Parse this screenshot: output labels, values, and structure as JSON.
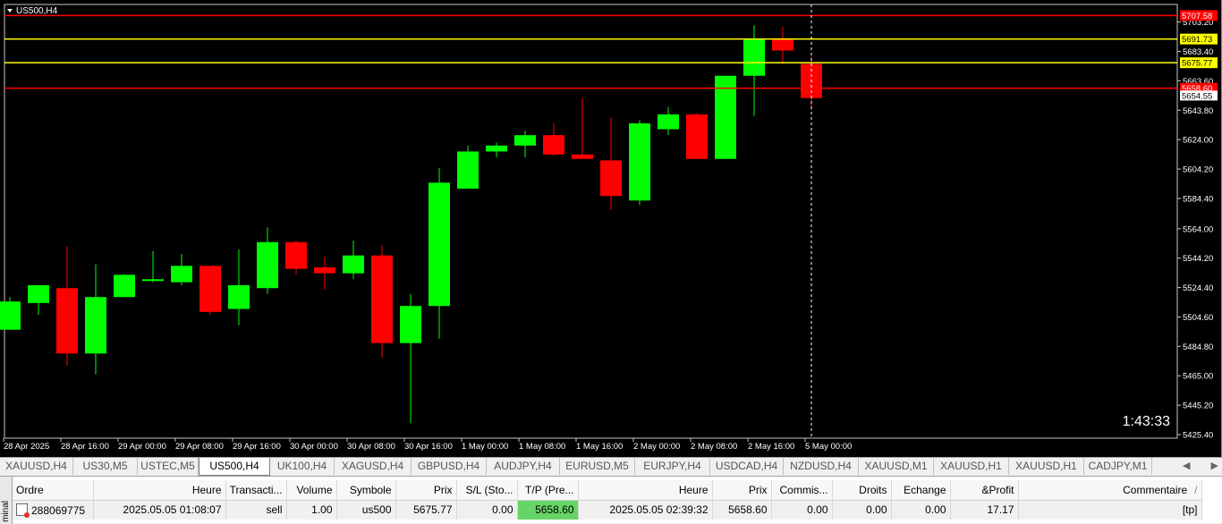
{
  "chart": {
    "title": "US500,H4",
    "timer": "1:43:33",
    "y_range": [
      5423,
      5715
    ],
    "price_labels": [
      "5703.20",
      "5683.40",
      "5663.60",
      "5643.80",
      "5624.00",
      "5604.20",
      "5584.40",
      "5564.00",
      "5544.20",
      "5524.40",
      "5504.60",
      "5484.80",
      "5465.00",
      "5445.20",
      "5425.40"
    ],
    "time_labels": [
      "28 Apr 2025",
      "28 Apr 16:00",
      "29 Apr 00:00",
      "29 Apr 08:00",
      "29 Apr 16:00",
      "30 Apr 00:00",
      "30 Apr 08:00",
      "30 Apr 16:00",
      "1 May 00:00",
      "1 May 08:00",
      "1 May 16:00",
      "2 May 00:00",
      "2 May 08:00",
      "2 May 16:00",
      "5 May 00:00"
    ],
    "levels": [
      {
        "price": 5707.58,
        "label": "5707.58",
        "line_color": "#ff0000",
        "badge_color": "#ff0000",
        "text_color": "#ffffff"
      },
      {
        "price": 5691.73,
        "label": "5691.73",
        "line_color": "#ffff00",
        "badge_color": "#ffff00",
        "text_color": "#000000"
      },
      {
        "price": 5675.77,
        "label": "5675.77",
        "line_color": "#ffff00",
        "badge_color": "#ffff00",
        "text_color": "#000000"
      },
      {
        "price": 5658.6,
        "label": "5658.60",
        "line_color": "#ff0000",
        "badge_color": "#ff0000",
        "text_color": "#ffffff"
      }
    ],
    "current_price": {
      "price": 5654.55,
      "label": "5654.55"
    },
    "colors": {
      "bull": "#00ff00",
      "bear": "#ff0000",
      "wick_bull": "#00ff00",
      "wick_bear": "#ff0000",
      "background": "#000000",
      "text": "#ffffff"
    }
  },
  "chart_data": {
    "type": "candlestick",
    "series": [
      {
        "name": "US500,H4",
        "candles": [
          {
            "o": 5496,
            "h": 5518,
            "l": 5496,
            "c": 5515
          },
          {
            "o": 5514,
            "h": 5524,
            "l": 5506,
            "c": 5526
          },
          {
            "o": 5524,
            "h": 5552,
            "l": 5472,
            "c": 5480
          },
          {
            "o": 5480,
            "h": 5540,
            "l": 5466,
            "c": 5518
          },
          {
            "o": 5518,
            "h": 5533,
            "l": 5518,
            "c": 5533
          },
          {
            "o": 5530,
            "h": 5549,
            "l": 5528,
            "c": 5530
          },
          {
            "o": 5528,
            "h": 5547,
            "l": 5526,
            "c": 5539
          },
          {
            "o": 5539,
            "h": 5539,
            "l": 5506,
            "c": 5508
          },
          {
            "o": 5510,
            "h": 5550,
            "l": 5499,
            "c": 5526
          },
          {
            "o": 5524,
            "h": 5565,
            "l": 5520,
            "c": 5555
          },
          {
            "o": 5555,
            "h": 5556,
            "l": 5533,
            "c": 5537
          },
          {
            "o": 5538,
            "h": 5545,
            "l": 5523,
            "c": 5534
          },
          {
            "o": 5534,
            "h": 5556,
            "l": 5530,
            "c": 5546
          },
          {
            "o": 5546,
            "h": 5553,
            "l": 5477,
            "c": 5487
          },
          {
            "o": 5487,
            "h": 5520,
            "l": 5433,
            "c": 5512
          },
          {
            "o": 5512,
            "h": 5605,
            "l": 5490,
            "c": 5595
          },
          {
            "o": 5591,
            "h": 5620,
            "l": 5591,
            "c": 5616
          },
          {
            "o": 5616,
            "h": 5622,
            "l": 5612,
            "c": 5620
          },
          {
            "o": 5620,
            "h": 5630,
            "l": 5612,
            "c": 5627
          },
          {
            "o": 5627,
            "h": 5635,
            "l": 5613,
            "c": 5614
          },
          {
            "o": 5614,
            "h": 5652,
            "l": 5611,
            "c": 5611
          },
          {
            "o": 5610,
            "h": 5639,
            "l": 5577,
            "c": 5586
          },
          {
            "o": 5583,
            "h": 5637,
            "l": 5580,
            "c": 5635
          },
          {
            "o": 5631,
            "h": 5646,
            "l": 5627,
            "c": 5641
          },
          {
            "o": 5641,
            "h": 5642,
            "l": 5611,
            "c": 5611
          },
          {
            "o": 5611,
            "h": 5667,
            "l": 5611,
            "c": 5667
          },
          {
            "o": 5667,
            "h": 5701,
            "l": 5640,
            "c": 5692
          },
          {
            "o": 5692,
            "h": 5700,
            "l": 5675,
            "c": 5684
          },
          {
            "o": 5675,
            "h": 5680,
            "l": 5644,
            "c": 5652
          }
        ]
      }
    ],
    "x": [
      "28 Apr 2025",
      "28 Apr 16:00",
      "29 Apr 00:00",
      "29 Apr 08:00",
      "29 Apr 16:00",
      "30 Apr 00:00",
      "30 Apr 08:00",
      "30 Apr 16:00",
      "1 May 00:00",
      "1 May 08:00",
      "1 May 16:00",
      "2 May 00:00",
      "2 May 08:00",
      "2 May 16:00",
      "5 May 00:00"
    ],
    "ylim": [
      5423,
      5715
    ],
    "grid": false
  },
  "symbol_tabs": {
    "items": [
      "XAUUSD,H4",
      "US30,M5",
      "USTEC,M5",
      "US500,H4",
      "UK100,H4",
      "XAGUSD,H4",
      "GBPUSD,H4",
      "AUDJPY,H4",
      "EURUSD,M5",
      "EURJPY,H4",
      "USDCAD,H4",
      "NZDUSD,H4",
      "XAUUSD,M1",
      "XAUUSD,H1",
      "XAUUSD,H1",
      "CADJPY,M1"
    ],
    "active_index": 3
  },
  "terminal": {
    "side_label": "minal",
    "headers": [
      "Ordre",
      "Heure",
      "Transacti...",
      "Volume",
      "Symbole",
      "Prix",
      "S/L (Sto...",
      "T/P (Pre...",
      "Heure",
      "Prix",
      "Commis...",
      "Droits",
      "Echange",
      "&Profit",
      "Commentaire"
    ],
    "rows": [
      [
        "288069775",
        "2025.05.05 01:08:07",
        "sell",
        "1.00",
        "us500",
        "5675.77",
        "0.00",
        "5658.60",
        "2025.05.05 02:39:32",
        "5658.60",
        "0.00",
        "0.00",
        "0.00",
        "17.17",
        "[tp]"
      ]
    ],
    "sort_icon": "/"
  }
}
